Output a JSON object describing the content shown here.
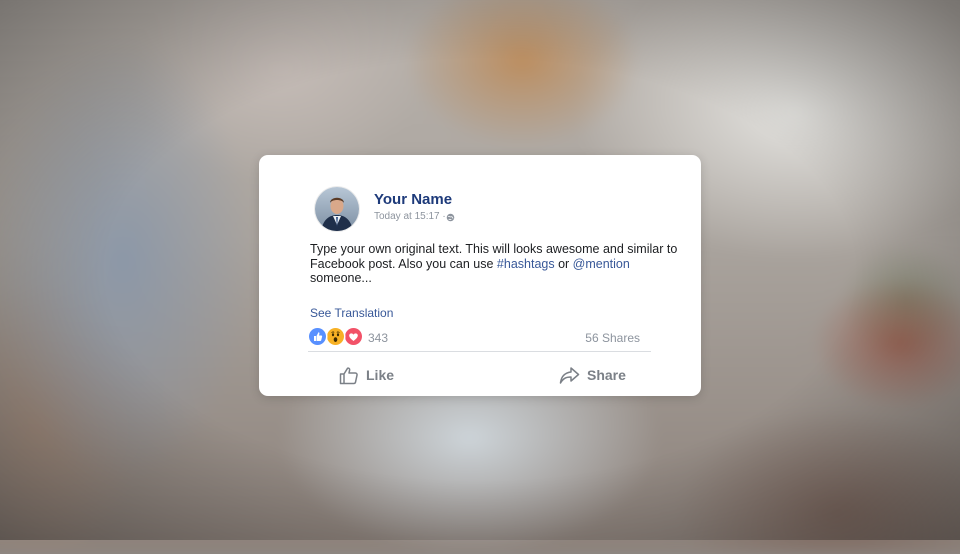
{
  "post": {
    "author_name": "Your Name",
    "timestamp": "Today at 15:17 ·",
    "text_part1": "Type your own original text. This will looks awesome and similar to Facebook post. Also you can use ",
    "hashtag": "#hashtags",
    "text_part2": " or ",
    "mention": "@mention",
    "text_part3": " someone...",
    "see_translation": "See Translation",
    "reaction_count": "343",
    "shares": "56 Shares",
    "reactions": [
      "like-icon",
      "wow-icon",
      "love-icon"
    ]
  },
  "actions": {
    "like_label": "Like",
    "share_label": "Share"
  },
  "colors": {
    "name": "#1d3a7a",
    "link": "#385898",
    "muted": "#8d949e",
    "like_reaction": "#5890ff",
    "wow_reaction": "#f7b125",
    "love_reaction": "#f25268"
  }
}
